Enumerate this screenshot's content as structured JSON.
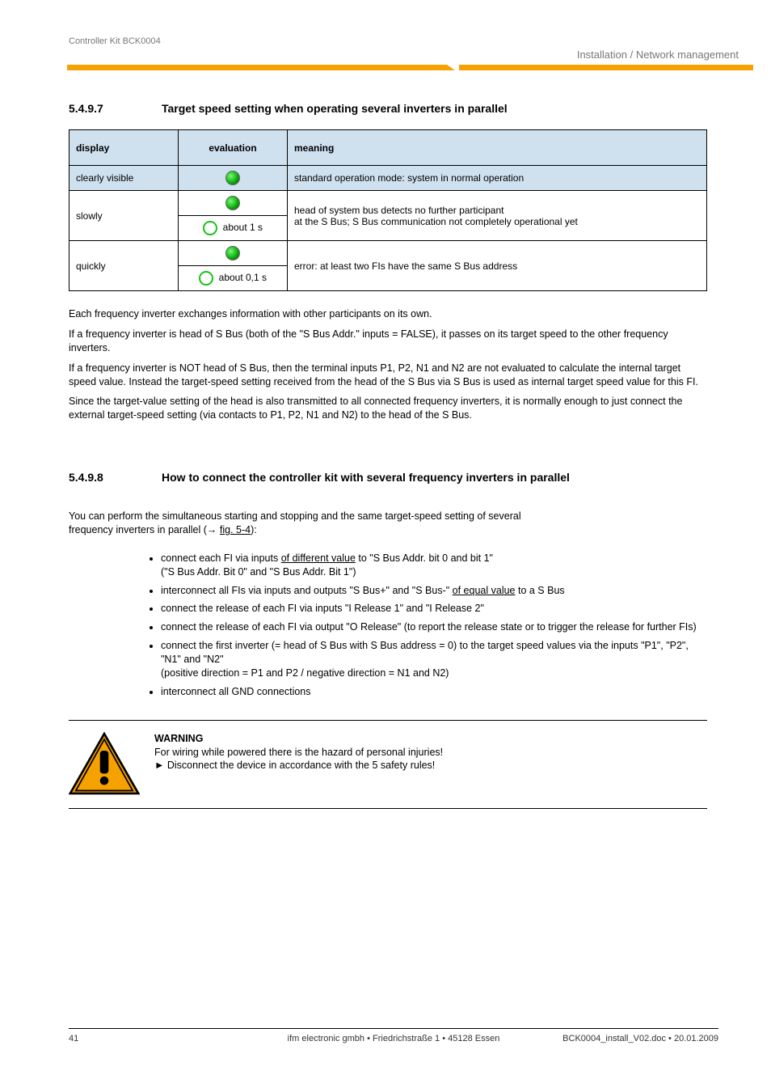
{
  "header": {
    "right_label": "Installation / Network management",
    "left_label": "Controller Kit BCK0004"
  },
  "section1": {
    "number": "5.4.9.7",
    "title": "Target speed setting when operating several inverters in parallel"
  },
  "table": {
    "h0": "display",
    "h1": "evaluation",
    "h2": "meaning",
    "rows": [
      {
        "col1": "clearly visible",
        "dot": "on",
        "desc": "standard operation mode: system in normal operation"
      },
      {
        "col1_r": "slowly",
        "dot1": "on",
        "dot2": "off",
        "desc1": "about 1 s",
        "desc2_a": "head of system bus detects no further participant",
        "desc2_b": "at the S Bus; S Bus communication not completely operational yet"
      },
      {
        "col1_r": "quickly",
        "dot1": "on",
        "dot2": "off",
        "desc1": "about 0,1 s",
        "desc2_a": "",
        "desc2_b": "error: at least two FIs have the same S Bus address"
      }
    ]
  },
  "para1_a": "Each frequency inverter exchanges information with other participants on its own.",
  "para1_b": "If a frequency inverter is head of S Bus (both of the \"S Bus Addr.\" inputs = FALSE), it passes on its target speed to the other frequency inverters.",
  "para1_c": "If a frequency inverter is NOT head of S Bus, then the terminal inputs P1, P2, N1 and N2 are not evaluated to calculate the internal target speed value. Instead the target-speed setting received from the head of the S Bus via S Bus is used as internal target speed value for this FI.",
  "para1_d": "Since the target-value setting of the head is also transmitted to all connected frequency inverters, it is normally enough to just connect the external target-speed setting (via contacts to P1, P2, N1 and N2) to the head of the S Bus.",
  "section2": {
    "number": "5.4.9.8",
    "title": "How to connect the controller kit with several frequency inverters in parallel"
  },
  "p2_a": "You can perform the simultaneous starting and stopping and the same target-speed setting of several",
  "p2_b_pre": "frequency inverters in parallel (→ ",
  "p2_b_link": "fig. 5-4",
  "p2_b_post": "):",
  "bullets": [
    {
      "pre": "connect each FI via inputs ",
      "u": "of different value",
      "post": " to \"S Bus Addr. bit 0 and bit 1\"",
      "sub": "(\"S Bus Addr. Bit 0\" and \"S Bus Addr. Bit 1\")"
    },
    {
      "pre": "interconnect all FIs via inputs and outputs \"S Bus+\" and \"S Bus-\" ",
      "u": "of equal value",
      "post": " to a S Bus",
      "sub": ""
    },
    {
      "pre": "connect the release of each FI via inputs \"I Release 1\" and \"I Release 2\"",
      "u": "",
      "post": "",
      "sub": ""
    },
    {
      "pre": "connect the release of each FI via output \"O Release\" (to report the release state or to trigger the release for further FIs)",
      "u": "",
      "post": "",
      "sub": ""
    },
    {
      "pre": "connect the first inverter (= head of S Bus with S Bus address = 0) to the target speed values via the inputs \"P1\", \"P2\", \"N1\" and \"N2\"",
      "sub": "(positive direction = P1 and P2 / negative direction = N1 and N2)"
    },
    {
      "pre": "interconnect all GND connections",
      "u": "",
      "post": "",
      "sub": ""
    }
  ],
  "warn": {
    "bold": "WARNING",
    "l1": "For wiring while powered there is the hazard of personal injuries!",
    "l2": "► Disconnect the device in accordance with the 5 safety rules!"
  },
  "footer": {
    "left": "41",
    "mid": "ifm electronic gmbh • Friedrichstraße 1 • 45128 Essen",
    "right": "BCK0004_install_V02.doc • 20.01.2009"
  }
}
